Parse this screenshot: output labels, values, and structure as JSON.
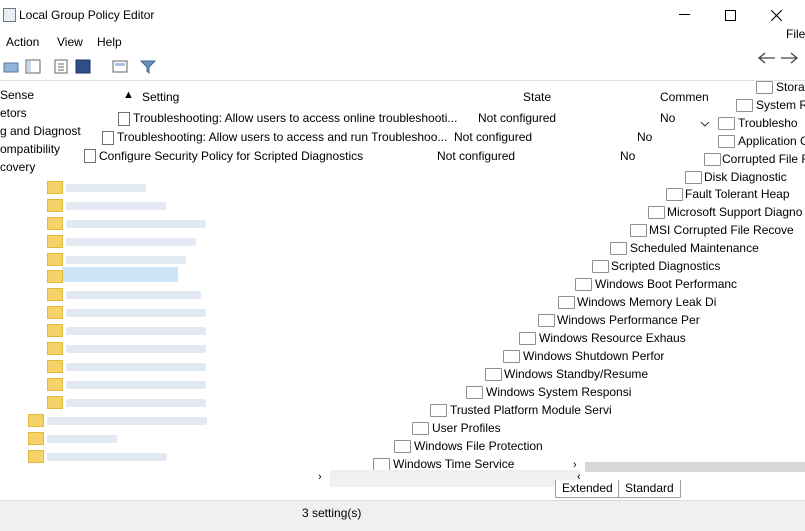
{
  "window": {
    "title": "Local Group Policy Editor"
  },
  "menu": {
    "items": [
      "Action",
      "View",
      "Help"
    ],
    "file_ghost": "File"
  },
  "tree": {
    "items": [
      "Sense",
      "etors",
      "g and Diagnost",
      "ompatibility",
      "covery"
    ]
  },
  "list": {
    "columns": {
      "setting": "Setting",
      "state": "State",
      "comment": "Commen"
    },
    "rows": [
      {
        "setting": "Troubleshooting: Allow users to access online troubleshooti...",
        "state": "Not configured",
        "comment": "No"
      },
      {
        "setting": "Troubleshooting: Allow users to access and run Troubleshoo...",
        "state": "Not configured",
        "comment": "No"
      },
      {
        "setting": "Configure Security Policy for Scripted Diagnostics",
        "state": "Not configured",
        "comment": "No"
      }
    ]
  },
  "explorer_items": [
    "Storag",
    "System R",
    "Troublesho",
    "Application C",
    "Corrupted File R",
    "Disk Diagnostic",
    "Fault Tolerant Heap",
    "Microsoft Support Diagno",
    "MSI Corrupted File Recove",
    "Scheduled Maintenance",
    "Scripted Diagnostics",
    "Windows Boot Performanc",
    "Windows Memory Leak Di",
    "Windows Performance Per",
    "Windows Resource Exhaus",
    "Windows Shutdown Perfor",
    "Windows Standby/Resume",
    "Windows System Responsi",
    "Trusted Platform Module Servi",
    "User Profiles",
    "Windows File Protection",
    "Windows Time Service"
  ],
  "tabs": {
    "extended": "Extended",
    "standard": "Standard"
  },
  "status": {
    "text": "3 setting(s)"
  },
  "colors": {
    "selection": "#cce4f7",
    "folder": "#f5d36a"
  }
}
